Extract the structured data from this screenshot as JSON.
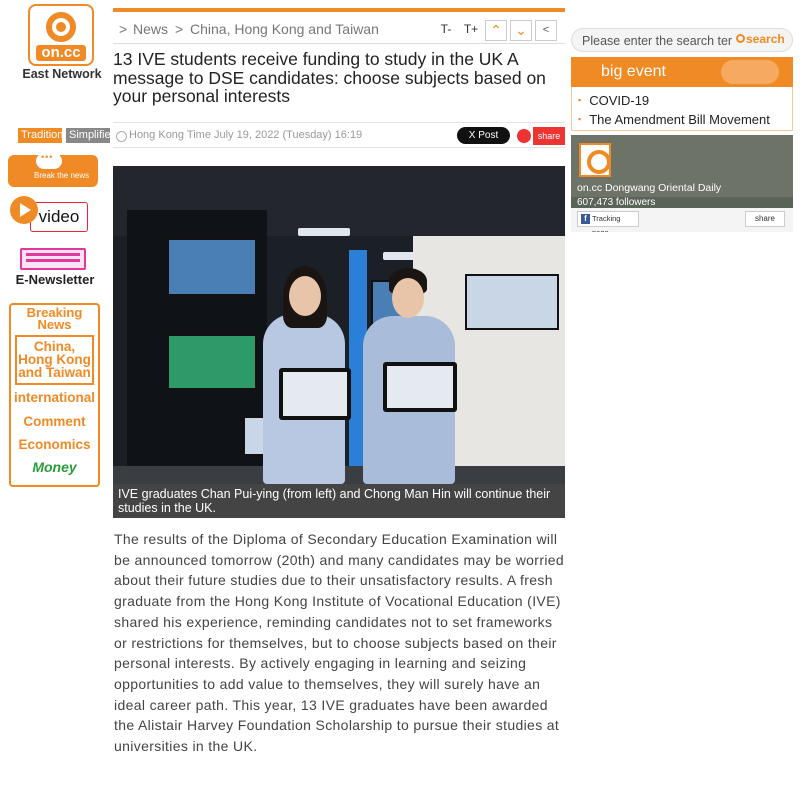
{
  "brand": {
    "logo_text": "on.cc",
    "name": "East Network"
  },
  "language": {
    "traditional": "Traditional",
    "simplified": "Simplified"
  },
  "sidebar": {
    "break_news": "Break the news",
    "video": "video",
    "enewsletter": "E-Newsletter",
    "nav": {
      "breaking": "Breaking News",
      "active": "China, Hong Kong and Taiwan",
      "international": "international",
      "comment": "Comment",
      "economics": "Economics",
      "money": "Money"
    }
  },
  "breadcrumb": {
    "sep": ">",
    "section": "News",
    "subsection": "China, Hong Kong and Taiwan"
  },
  "toolbar": {
    "font_smaller": "T-",
    "font_larger": "T+",
    "prev_icon": "chevron-up-icon",
    "next_icon": "chevron-down-icon",
    "back_icon": "chevron-left-icon"
  },
  "article": {
    "headline": "13 IVE students receive funding to study in the UK A message to DSE candidates: choose subjects based on your personal interests",
    "time": "Hong Kong Time July 19, 2022 (Tuesday) 16:19",
    "x_post": "X Post",
    "share": "share",
    "caption": "IVE graduates Chan Pui-ying (from left) and  Chong Man Hin  will continue their studies in the UK.",
    "body": "The results of the Diploma of Secondary Education Examination will be announced tomorrow (20th) and many candidates may be worried about their future studies due to their unsatisfactory results. A fresh graduate from the Hong Kong Institute of Vocational Education (IVE) shared his experience, reminding candidates not to set frameworks or restrictions for themselves, but to choose subjects based on their personal interests. By actively engaging in learning and seizing opportunities to add value to themselves, they will surely have an ideal career path. This year, 13 IVE graduates have been awarded the Alistair Harvey Foundation Scholarship to pursue their studies at universities in the UK."
  },
  "search": {
    "placeholder": "Please enter the search term",
    "button": "search"
  },
  "big_event": {
    "title": "big event",
    "items": [
      "COVID-19",
      "The Amendment Bill Movement"
    ]
  },
  "facebook": {
    "page_name": "on.cc Dongwang Oriental Daily",
    "followers": "607,473 followers",
    "follow_button": "Tracking page",
    "share_button": "share"
  },
  "colors": {
    "accent": "#f08a24",
    "text": "#222222",
    "muted": "#999999"
  }
}
